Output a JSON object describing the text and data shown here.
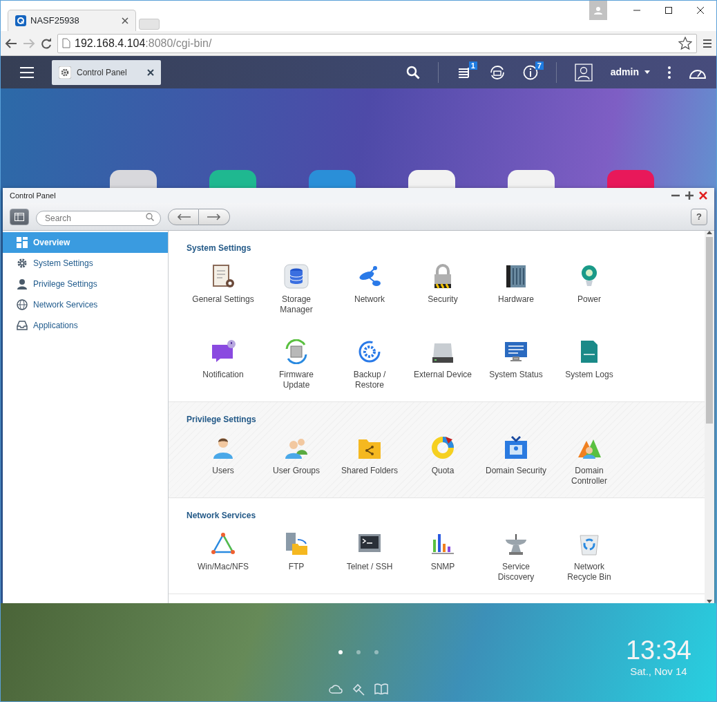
{
  "browser": {
    "tab_title": "NASF25938",
    "url_host": "192.168.4.104",
    "url_path": ":8080/cgi-bin/"
  },
  "topbar": {
    "app_tab": "Control Panel",
    "badges": [
      {
        "count": "1"
      },
      {
        "count": "7"
      }
    ],
    "user": "admin"
  },
  "window": {
    "title": "Control Panel",
    "search_placeholder": "Search",
    "help": "?"
  },
  "sidebar": {
    "items": [
      {
        "label": "Overview",
        "selected": true
      },
      {
        "label": "System Settings",
        "selected": false
      },
      {
        "label": "Privilege Settings",
        "selected": false
      },
      {
        "label": "Network Services",
        "selected": false
      },
      {
        "label": "Applications",
        "selected": false
      }
    ]
  },
  "sections": [
    {
      "title": "System Settings",
      "items": [
        {
          "label": "General Settings"
        },
        {
          "label": "Storage\nManager"
        },
        {
          "label": "Network"
        },
        {
          "label": "Security"
        },
        {
          "label": "Hardware"
        },
        {
          "label": "Power"
        },
        {
          "label": "Notification"
        },
        {
          "label": "Firmware\nUpdate"
        },
        {
          "label": "Backup /\nRestore"
        },
        {
          "label": "External Device"
        },
        {
          "label": "System Status"
        },
        {
          "label": "System Logs"
        }
      ]
    },
    {
      "title": "Privilege Settings",
      "items": [
        {
          "label": "Users"
        },
        {
          "label": "User Groups"
        },
        {
          "label": "Shared Folders"
        },
        {
          "label": "Quota"
        },
        {
          "label": "Domain Security"
        },
        {
          "label": "Domain\nController"
        }
      ]
    },
    {
      "title": "Network Services",
      "items": [
        {
          "label": "Win/Mac/NFS"
        },
        {
          "label": "FTP"
        },
        {
          "label": "Telnet / SSH"
        },
        {
          "label": "SNMP"
        },
        {
          "label": "Service\nDiscovery"
        },
        {
          "label": "Network\nRecycle Bin"
        }
      ]
    }
  ],
  "desktop": {
    "pager": [
      {
        "selected": true
      },
      {
        "selected": false
      },
      {
        "selected": false
      }
    ],
    "time": "13:34",
    "date": "Sat., Nov 14"
  }
}
